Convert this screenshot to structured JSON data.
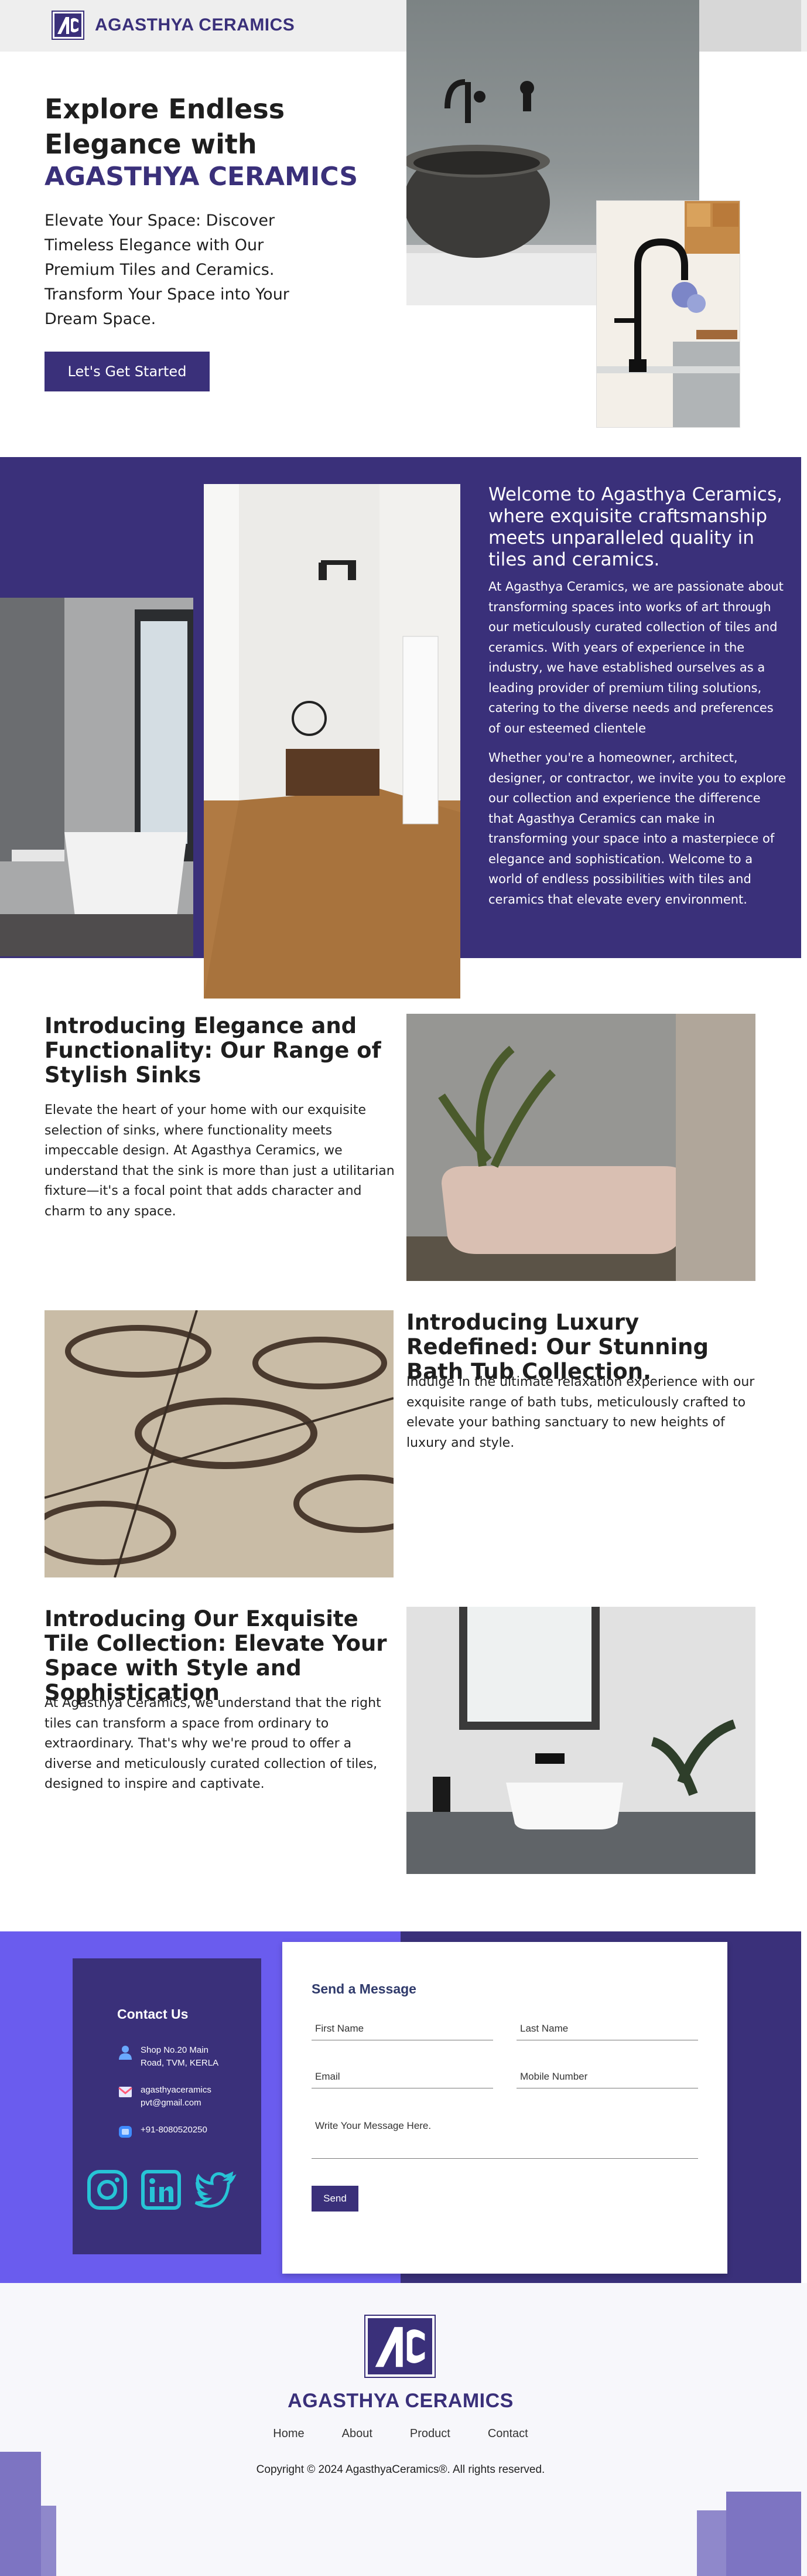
{
  "brand": {
    "name": "AGASTHYA CERAMICS",
    "logo_letters": "AC"
  },
  "nav": {
    "items": [
      "Home",
      "About",
      "Product",
      "Contact"
    ],
    "active": "Home"
  },
  "hero": {
    "title": "Explore Endless Elegance with",
    "brand": "AGASTHYA CERAMICS",
    "subtitle": "Elevate Your Space: Discover Timeless Elegance with Our Premium Tiles and Ceramics. Transform Your Space into Your Dream Space.",
    "cta": "Let's Get Started"
  },
  "about": {
    "title": "Welcome to Agasthya Ceramics, where exquisite craftsmanship meets unparalleled quality in tiles and ceramics.",
    "p1": "At Agasthya Ceramics, we are passionate about transforming spaces into works of art through our meticulously curated collection of tiles and ceramics. With years of experience in the industry, we have established ourselves as a leading provider of premium tiling solutions, catering to the diverse needs and preferences of our esteemed clientele",
    "p2": "Whether you're a homeowner, architect, designer, or contractor, we invite you to explore our collection and experience the difference that Agasthya Ceramics can make in transforming your space into a masterpiece of elegance and sophistication. Welcome to a world of endless possibilities with tiles and ceramics that elevate every environment."
  },
  "sections": [
    {
      "title": "Introducing Elegance and Functionality: Our Range of Stylish Sinks",
      "body": "Elevate the heart of your home with our exquisite selection of sinks, where functionality meets impeccable design. At Agasthya Ceramics, we understand that the sink is more than just a utilitarian fixture—it's a focal point that adds character and charm to any space."
    },
    {
      "title": "Introducing Luxury Redefined: Our Stunning Bath Tub Collection.",
      "body": "Indulge in the ultimate relaxation experience with our exquisite range of bath tubs, meticulously crafted to elevate your bathing sanctuary to new heights of luxury and style."
    },
    {
      "title": "Introducing Our Exquisite Tile Collection: Elevate Your Space with Style and Sophistication",
      "body": "At Agasthya Ceramics, we understand that the right tiles can transform a space from ordinary to extraordinary. That's why we're proud to offer a diverse and meticulously curated collection of tiles, designed to inspire and captivate."
    }
  ],
  "contact": {
    "title": "Contact Us",
    "address": "Shop No.20 Main Road, TVM, KERLA",
    "email": "agasthyaceramics pvt@gmail.com",
    "phone": "+91-8080520250",
    "form_title": "Send a Message",
    "placeholders": {
      "first": "First Name",
      "last": "Last Name",
      "email": "Email",
      "mobile": "Mobile Number",
      "message": "Write Your Message Here."
    },
    "send": "Send"
  },
  "footer": {
    "copyright": "Copyright © 2024 AgasthyaCeramics®. All rights reserved."
  },
  "colors": {
    "primary": "#3a307a",
    "accent": "#6a5cee",
    "social": "#27c4d6"
  },
  "icons": [
    "location-icon",
    "email-icon",
    "phone-icon",
    "instagram-icon",
    "linkedin-icon",
    "twitter-icon"
  ]
}
